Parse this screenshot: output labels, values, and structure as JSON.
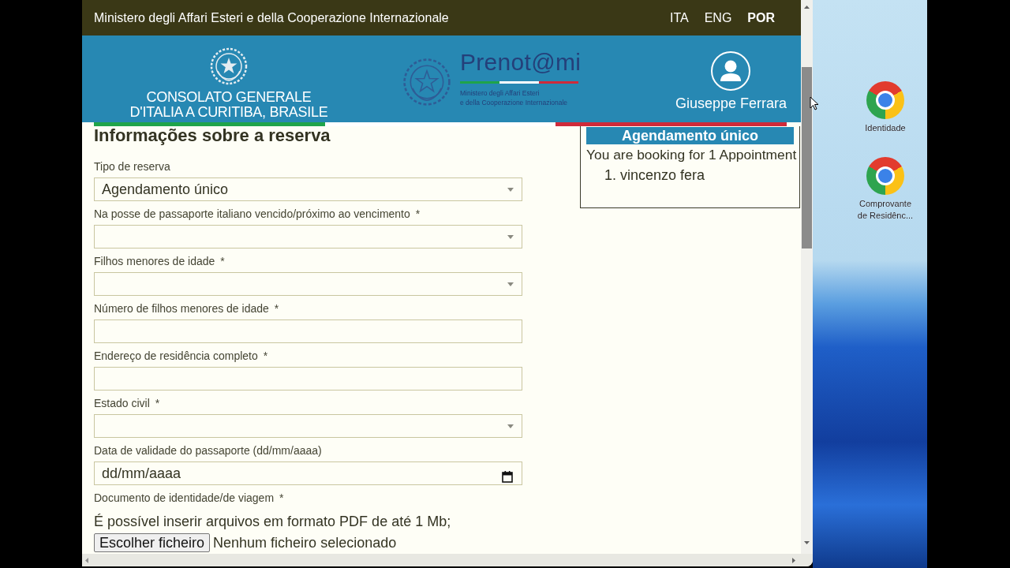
{
  "top_bar": {
    "title": "Ministero degli Affari Esteri e della Cooperazione Internazionale",
    "languages": [
      {
        "label": "ITA",
        "selected": false
      },
      {
        "label": "ENG",
        "selected": false
      },
      {
        "label": "POR",
        "selected": true
      }
    ]
  },
  "header": {
    "consulate_lines": [
      "CONSOLATO GENERALE",
      "D'ITALIA A CURITIBA, BRASILE"
    ],
    "logo": {
      "name": "Prenot@mi",
      "subtitle_lines": [
        "Ministero degli Affari Esteri",
        "e della Cooperazione Internazionale"
      ]
    },
    "user": {
      "name": "Giuseppe Ferrara"
    }
  },
  "form": {
    "title": "Informações sobre a reserva",
    "fields": [
      {
        "kind": "select",
        "label": "Tipo de reserva",
        "value": "Agendamento único"
      },
      {
        "kind": "select",
        "label": "Na posse de passaporte italiano vencido/próximo ao vencimento",
        "required_mark": "*"
      },
      {
        "kind": "select",
        "label": "Filhos menores de idade",
        "required_mark": "*"
      },
      {
        "kind": "text",
        "label": "Número de filhos menores de idade",
        "required_mark": "*"
      },
      {
        "kind": "text",
        "label": "Endereço de residência completo",
        "required_mark": "*"
      },
      {
        "kind": "select",
        "label": "Estado civil",
        "required_mark": "*"
      },
      {
        "kind": "date",
        "label": "Data de validade do passaporte (dd/mm/aaaa)",
        "placeholder": "dd/mm/aaaa"
      },
      {
        "kind": "file",
        "label": "Documento de identidade/de viagem",
        "required_mark": "*",
        "note": "É possível inserir arquivos em formato PDF de até 1 Mb;",
        "button": "Escolher ficheiro",
        "status": "Nenhum ficheiro selecionado"
      }
    ]
  },
  "summary": {
    "title": "Agendamento único",
    "text": "You are booking for 1 Appointment",
    "people": [
      {
        "number": "1.",
        "name": "vincenzo fera"
      }
    ]
  },
  "desktop": {
    "shortcuts": [
      {
        "label": "Identidade"
      },
      {
        "label": "Comprovante de Residênc..."
      }
    ]
  }
}
